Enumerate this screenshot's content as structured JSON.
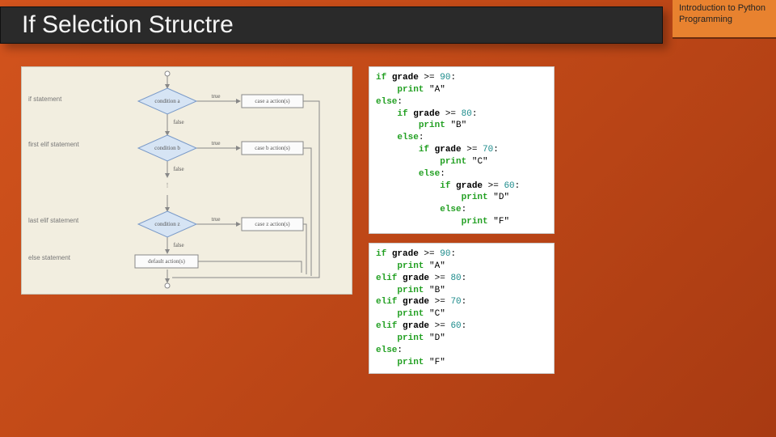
{
  "header": {
    "title": "If Selection Structre",
    "corner": "Introduction to Python Programming"
  },
  "flow": {
    "labels": {
      "if": "if statement",
      "first_elif": "first elif\nstatement",
      "last_elif": "last elif\nstatement",
      "else": "else\nstatement"
    },
    "conditions": {
      "a": "condition a",
      "b": "condition b",
      "z": "condition z"
    },
    "actions": {
      "a": "case a action(s)",
      "b": "case b action(s)",
      "z": "case z action(s)",
      "default": "default action(s)"
    },
    "edge": {
      "true": "true",
      "false": "false"
    }
  },
  "code_nested": [
    {
      "i": 0,
      "t": [
        {
          "c": "kw",
          "s": "if"
        },
        {
          "c": "op",
          "s": " "
        },
        {
          "c": "id",
          "s": "grade"
        },
        {
          "c": "op",
          "s": " >= "
        },
        {
          "c": "num",
          "s": "90"
        },
        {
          "c": "op",
          "s": ":"
        }
      ]
    },
    {
      "i": 1,
      "t": [
        {
          "c": "kw",
          "s": "print"
        },
        {
          "c": "op",
          "s": " "
        },
        {
          "c": "str",
          "s": "\"A\""
        }
      ]
    },
    {
      "i": 0,
      "t": [
        {
          "c": "kw",
          "s": "else"
        },
        {
          "c": "op",
          "s": ":"
        }
      ]
    },
    {
      "i": 1,
      "t": [
        {
          "c": "kw",
          "s": "if"
        },
        {
          "c": "op",
          "s": " "
        },
        {
          "c": "id",
          "s": "grade"
        },
        {
          "c": "op",
          "s": " >= "
        },
        {
          "c": "num",
          "s": "80"
        },
        {
          "c": "op",
          "s": ":"
        }
      ]
    },
    {
      "i": 2,
      "t": [
        {
          "c": "kw",
          "s": "print"
        },
        {
          "c": "op",
          "s": " "
        },
        {
          "c": "str",
          "s": "\"B\""
        }
      ]
    },
    {
      "i": 1,
      "t": [
        {
          "c": "kw",
          "s": "else"
        },
        {
          "c": "op",
          "s": ":"
        }
      ]
    },
    {
      "i": 2,
      "t": [
        {
          "c": "kw",
          "s": "if"
        },
        {
          "c": "op",
          "s": " "
        },
        {
          "c": "id",
          "s": "grade"
        },
        {
          "c": "op",
          "s": " >= "
        },
        {
          "c": "num",
          "s": "70"
        },
        {
          "c": "op",
          "s": ":"
        }
      ]
    },
    {
      "i": 3,
      "t": [
        {
          "c": "kw",
          "s": "print"
        },
        {
          "c": "op",
          "s": " "
        },
        {
          "c": "str",
          "s": "\"C\""
        }
      ]
    },
    {
      "i": 2,
      "t": [
        {
          "c": "kw",
          "s": "else"
        },
        {
          "c": "op",
          "s": ":"
        }
      ]
    },
    {
      "i": 3,
      "t": [
        {
          "c": "kw",
          "s": "if"
        },
        {
          "c": "op",
          "s": " "
        },
        {
          "c": "id",
          "s": "grade"
        },
        {
          "c": "op",
          "s": " >= "
        },
        {
          "c": "num",
          "s": "60"
        },
        {
          "c": "op",
          "s": ":"
        }
      ]
    },
    {
      "i": 4,
      "t": [
        {
          "c": "kw",
          "s": "print"
        },
        {
          "c": "op",
          "s": " "
        },
        {
          "c": "str",
          "s": "\"D\""
        }
      ]
    },
    {
      "i": 3,
      "t": [
        {
          "c": "kw",
          "s": "else"
        },
        {
          "c": "op",
          "s": ":"
        }
      ]
    },
    {
      "i": 4,
      "t": [
        {
          "c": "kw",
          "s": "print"
        },
        {
          "c": "op",
          "s": " "
        },
        {
          "c": "str",
          "s": "\"F\""
        }
      ]
    }
  ],
  "code_elif": [
    {
      "i": 0,
      "t": [
        {
          "c": "kw",
          "s": "if"
        },
        {
          "c": "op",
          "s": " "
        },
        {
          "c": "id",
          "s": "grade"
        },
        {
          "c": "op",
          "s": " >= "
        },
        {
          "c": "num",
          "s": "90"
        },
        {
          "c": "op",
          "s": ":"
        }
      ]
    },
    {
      "i": 1,
      "t": [
        {
          "c": "kw",
          "s": "print"
        },
        {
          "c": "op",
          "s": " "
        },
        {
          "c": "str",
          "s": "\"A\""
        }
      ]
    },
    {
      "i": 0,
      "t": [
        {
          "c": "kw",
          "s": "elif"
        },
        {
          "c": "op",
          "s": " "
        },
        {
          "c": "id",
          "s": "grade"
        },
        {
          "c": "op",
          "s": " >= "
        },
        {
          "c": "num",
          "s": "80"
        },
        {
          "c": "op",
          "s": ":"
        }
      ]
    },
    {
      "i": 1,
      "t": [
        {
          "c": "kw",
          "s": "print"
        },
        {
          "c": "op",
          "s": " "
        },
        {
          "c": "str",
          "s": "\"B\""
        }
      ]
    },
    {
      "i": 0,
      "t": [
        {
          "c": "kw",
          "s": "elif"
        },
        {
          "c": "op",
          "s": " "
        },
        {
          "c": "id",
          "s": "grade"
        },
        {
          "c": "op",
          "s": " >= "
        },
        {
          "c": "num",
          "s": "70"
        },
        {
          "c": "op",
          "s": ":"
        }
      ]
    },
    {
      "i": 1,
      "t": [
        {
          "c": "kw",
          "s": "print"
        },
        {
          "c": "op",
          "s": " "
        },
        {
          "c": "str",
          "s": "\"C\""
        }
      ]
    },
    {
      "i": 0,
      "t": [
        {
          "c": "kw",
          "s": "elif"
        },
        {
          "c": "op",
          "s": " "
        },
        {
          "c": "id",
          "s": "grade"
        },
        {
          "c": "op",
          "s": " >= "
        },
        {
          "c": "num",
          "s": "60"
        },
        {
          "c": "op",
          "s": ":"
        }
      ]
    },
    {
      "i": 1,
      "t": [
        {
          "c": "kw",
          "s": "print"
        },
        {
          "c": "op",
          "s": " "
        },
        {
          "c": "str",
          "s": "\"D\""
        }
      ]
    },
    {
      "i": 0,
      "t": [
        {
          "c": "kw",
          "s": "else"
        },
        {
          "c": "op",
          "s": ":"
        }
      ]
    },
    {
      "i": 1,
      "t": [
        {
          "c": "kw",
          "s": "print"
        },
        {
          "c": "op",
          "s": " "
        },
        {
          "c": "str",
          "s": "\"F\""
        }
      ]
    }
  ]
}
